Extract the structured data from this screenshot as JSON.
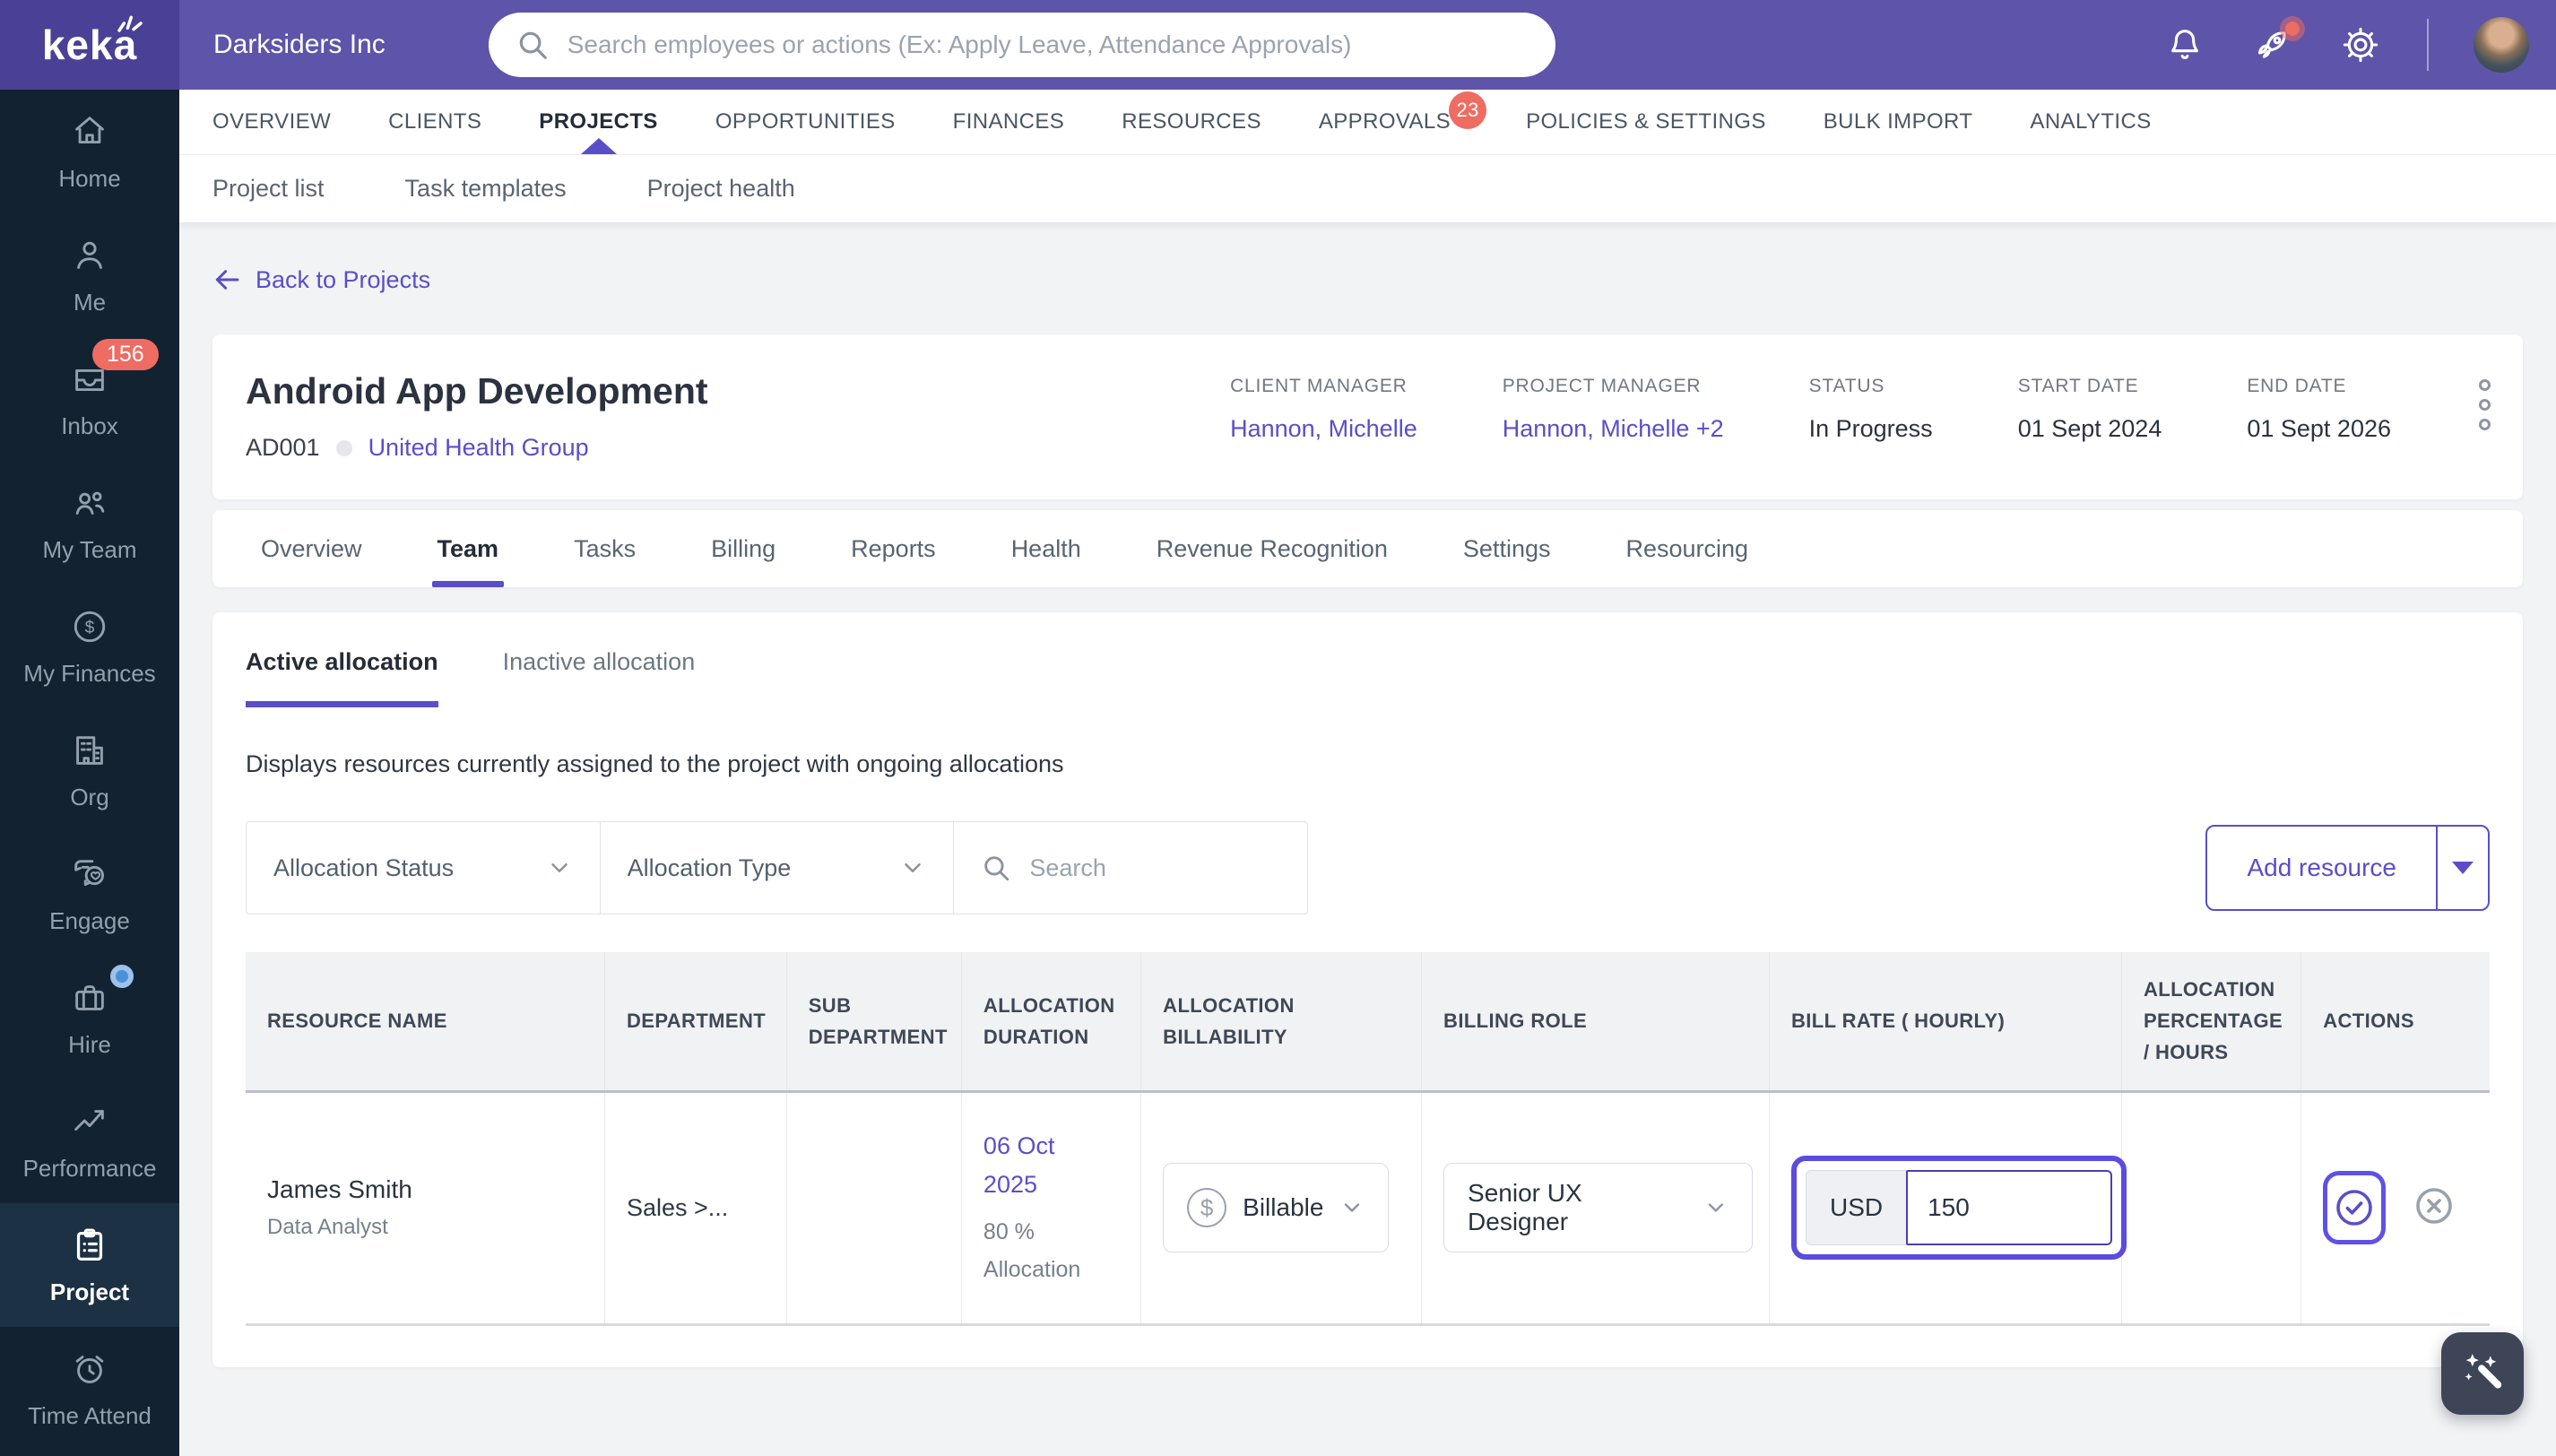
{
  "topbar": {
    "logo": "keka",
    "company": "Darksiders Inc",
    "search_placeholder": "Search employees or actions (Ex: Apply Leave, Attendance Approvals)"
  },
  "sidebar": {
    "items": [
      {
        "label": "Home",
        "icon": "home-icon"
      },
      {
        "label": "Me",
        "icon": "person-icon"
      },
      {
        "label": "Inbox",
        "icon": "inbox-tray-icon",
        "badge": "156"
      },
      {
        "label": "My Team",
        "icon": "team-icon"
      },
      {
        "label": "My Finances",
        "icon": "dollar-circle-icon"
      },
      {
        "label": "Org",
        "icon": "building-icon"
      },
      {
        "label": "Engage",
        "icon": "chat-heart-icon"
      },
      {
        "label": "Hire",
        "icon": "briefcase-icon",
        "dot": true
      },
      {
        "label": "Performance",
        "icon": "trend-icon"
      },
      {
        "label": "Project",
        "icon": "clipboard-icon",
        "active": true
      },
      {
        "label": "Time Attend",
        "icon": "alarm-clock-icon"
      }
    ]
  },
  "mainnav": {
    "items": [
      {
        "label": "OVERVIEW"
      },
      {
        "label": "CLIENTS"
      },
      {
        "label": "PROJECTS",
        "active": true
      },
      {
        "label": "OPPORTUNITIES"
      },
      {
        "label": "FINANCES"
      },
      {
        "label": "RESOURCES"
      },
      {
        "label": "APPROVALS",
        "badge": "23"
      },
      {
        "label": "POLICIES & SETTINGS"
      },
      {
        "label": "BULK IMPORT"
      },
      {
        "label": "ANALYTICS"
      }
    ]
  },
  "subnav": {
    "items": [
      {
        "label": "Project list"
      },
      {
        "label": "Task templates"
      },
      {
        "label": "Project health"
      }
    ]
  },
  "back_link": "Back to Projects",
  "project": {
    "title": "Android App Development",
    "code": "AD001",
    "client": "United Health Group",
    "meta": [
      {
        "label": "CLIENT MANAGER",
        "value": "Hannon, Michelle"
      },
      {
        "label": "PROJECT MANAGER",
        "value": "Hannon, Michelle  +2"
      },
      {
        "label": "STATUS",
        "value": "In Progress"
      },
      {
        "label": "START DATE",
        "value": "01 Sept 2024"
      },
      {
        "label": "END DATE",
        "value": "01 Sept 2026"
      }
    ]
  },
  "project_tabs": {
    "items": [
      {
        "label": "Overview"
      },
      {
        "label": "Team",
        "active": true
      },
      {
        "label": "Tasks"
      },
      {
        "label": "Billing"
      },
      {
        "label": "Reports"
      },
      {
        "label": "Health"
      },
      {
        "label": "Revenue Recognition"
      },
      {
        "label": "Settings"
      },
      {
        "label": "Resourcing"
      }
    ]
  },
  "allocation_tabs": {
    "items": [
      {
        "label": "Active allocation",
        "active": true
      },
      {
        "label": "Inactive allocation"
      }
    ]
  },
  "description": "Displays resources currently assigned to the project with ongoing allocations",
  "filters": {
    "status_label": "Allocation Status",
    "type_label": "Allocation Type",
    "search_placeholder": "Search"
  },
  "add_resource_label": "Add resource",
  "table": {
    "columns": [
      "RESOURCE NAME",
      "DEPARTMENT",
      "SUB DEPARTMENT",
      "ALLOCATION DURATION",
      "ALLOCATION BILLABILITY",
      "BILLING ROLE",
      "BILL RATE ( HOURLY)",
      "ALLOCATION PERCENTAGE / HOURS",
      "ACTIONS"
    ],
    "row": {
      "name": "James Smith",
      "role": "Data Analyst",
      "department": "Sales >...",
      "sub_department": "",
      "duration_date": "06 Oct 2025",
      "duration_detail": "80 % Allocation",
      "billability": "Billable",
      "billing_role": "Senior UX Designer",
      "currency": "USD",
      "rate": "150",
      "allocation_percentage": ""
    }
  },
  "icons": {
    "topbar": [
      "search-icon",
      "bell-icon",
      "rocket-icon",
      "gear-icon"
    ],
    "floating": "magic-wand-icon"
  },
  "colors": {
    "topbar": "#5e54a9",
    "logo_bg": "#4a4196",
    "sidebar_bg": "#132231",
    "sidebar_active_bg": "#1c3143",
    "accent": "#5a4ec8",
    "focus_ring": "#5b4be0",
    "badge": "#ee6c62",
    "hire_dot": "#4a90d9",
    "page_bg": "#f2f3f5",
    "table_header_bg": "#f0f2f4"
  }
}
